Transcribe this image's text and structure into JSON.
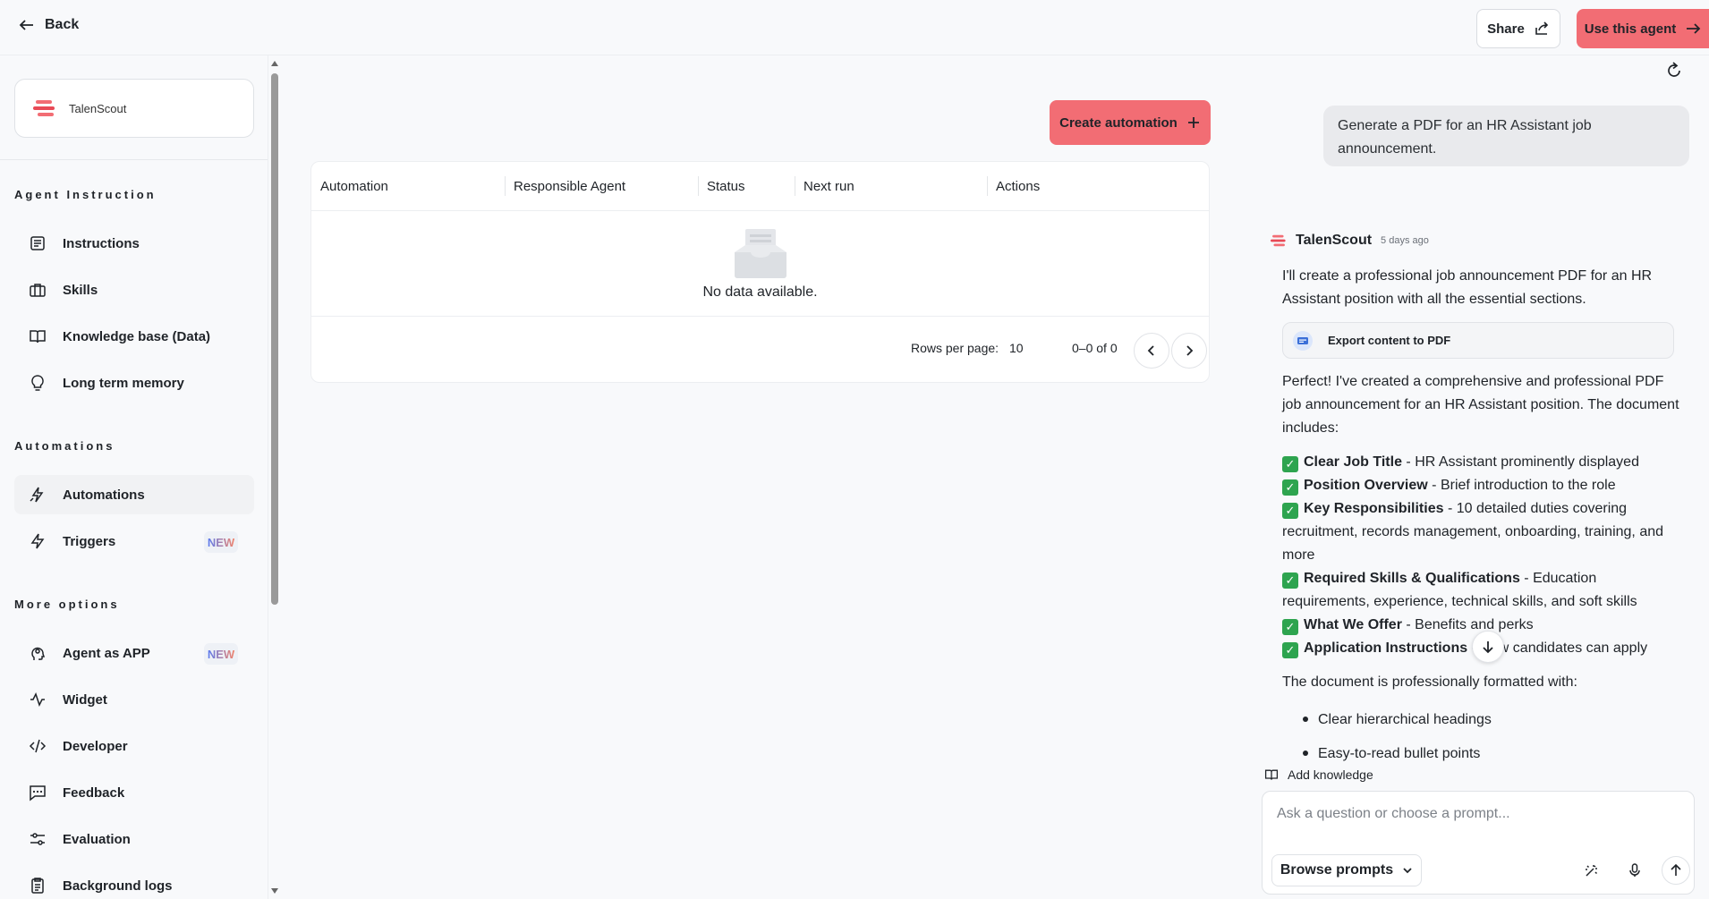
{
  "topbar": {
    "back_label": "Back",
    "share_label": "Share",
    "use_agent_label": "Use this agent"
  },
  "sidebar": {
    "agent_name": "TalenScout",
    "sections": {
      "agent_instruction": "Agent Instruction",
      "automations": "Automations",
      "more_options": "More options"
    },
    "items": {
      "instructions": "Instructions",
      "skills": "Skills",
      "knowledge_base": "Knowledge base (Data)",
      "long_term_memory": "Long term memory",
      "automations": "Automations",
      "triggers": "Triggers",
      "agent_as_app": "Agent as APP",
      "widget": "Widget",
      "developer": "Developer",
      "feedback": "Feedback",
      "evaluation": "Evaluation",
      "background_logs": "Background logs"
    },
    "badge_new": "NEW"
  },
  "main": {
    "create_label": "Create automation",
    "table": {
      "columns": [
        "Automation",
        "Responsible Agent",
        "Status",
        "Next run",
        "Actions"
      ],
      "empty_text": "No data available.",
      "rows_per_page_label": "Rows per page:",
      "rows_per_page_value": "10",
      "range_text": "0–0 of 0"
    }
  },
  "chat": {
    "user_message": "Generate a PDF for an HR Assistant job announcement.",
    "bot_name": "TalenScout",
    "bot_time": "5 days ago",
    "intro": "I'll create a professional job announcement PDF for an HR Assistant position with all the essential sections.",
    "tool_label": "Export content to PDF",
    "summary": "Perfect! I've created a comprehensive and professional PDF job announcement for an HR Assistant position. The document includes:",
    "checks": [
      {
        "bold": "Clear Job Title",
        "rest": " - HR Assistant prominently displayed"
      },
      {
        "bold": "Position Overview",
        "rest": " - Brief introduction to the role"
      },
      {
        "bold": "Key Responsibilities",
        "rest": " - 10 detailed duties covering recruitment, records management, onboarding, training, and more"
      },
      {
        "bold": "Required Skills & Qualifications",
        "rest": " - Education requirements, experience, technical skills, and soft skills"
      },
      {
        "bold": "What We Offer",
        "rest": " - Benefits and perks"
      },
      {
        "bold": "Application Instructions",
        "rest": " - How candidates can apply"
      }
    ],
    "formatted_intro": "The document is professionally formatted with:",
    "bullets": [
      "Clear hierarchical headings",
      "Easy-to-read bullet points"
    ],
    "add_knowledge": "Add knowledge",
    "input_placeholder": "Ask a question or choose a prompt...",
    "browse_prompts": "Browse prompts"
  },
  "colors": {
    "accent": "#f26d74",
    "check_green": "#2ea44f"
  }
}
